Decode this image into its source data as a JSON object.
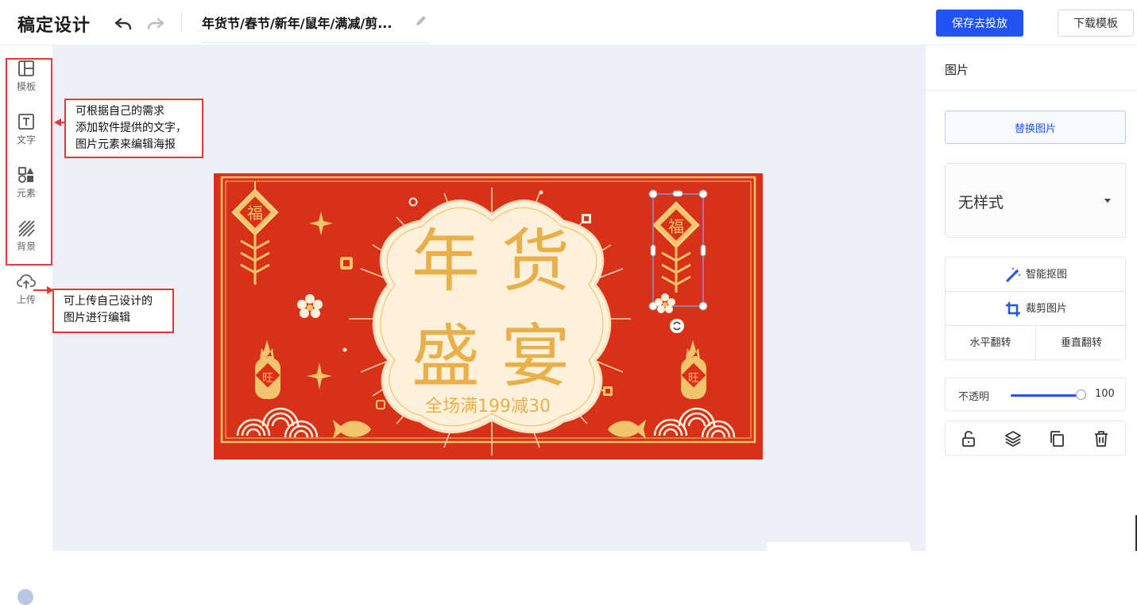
{
  "app": {
    "logo": "稿定设计"
  },
  "header": {
    "doc_title": "年货节/春节/新年/鼠年/满减/剪...",
    "save_btn": "保存去投放",
    "download_btn": "下载模板"
  },
  "sidebar": {
    "items": [
      {
        "label": "模板",
        "icon": "template-icon"
      },
      {
        "label": "文字",
        "icon": "text-icon"
      },
      {
        "label": "元素",
        "icon": "elements-icon"
      },
      {
        "label": "背景",
        "icon": "background-icon"
      },
      {
        "label": "上传",
        "icon": "upload-icon"
      }
    ]
  },
  "annotations": {
    "left_note": [
      "可根据自己的需求",
      "添加软件提供的文字，",
      "图片元素来编辑海报"
    ],
    "upload_note": [
      "可上传自己设计的",
      "图片进行编辑"
    ]
  },
  "poster": {
    "title_chars": [
      "年",
      "货",
      "盛",
      "宴"
    ],
    "subtitle": "全场满199减30",
    "fu_char": "福",
    "wang_char": "旺",
    "colors": {
      "bg": "#d93117",
      "gold": "#f2c46c",
      "cream": "#fdf1dc",
      "title": "#e9b04a"
    }
  },
  "right_panel": {
    "title": "图片",
    "replace_btn": "替换图片",
    "style_value": "无样式",
    "tools": {
      "smart_cutout": "智能抠图",
      "crop": "裁剪图片",
      "flip_h": "水平翻转",
      "flip_v": "垂直翻转"
    },
    "opacity": {
      "label": "不透明",
      "value": "100",
      "level": 1.0
    }
  },
  "colors": {
    "primary": "#2254f4",
    "annotation": "#e53935",
    "canvas_bg": "#eef0f7"
  }
}
